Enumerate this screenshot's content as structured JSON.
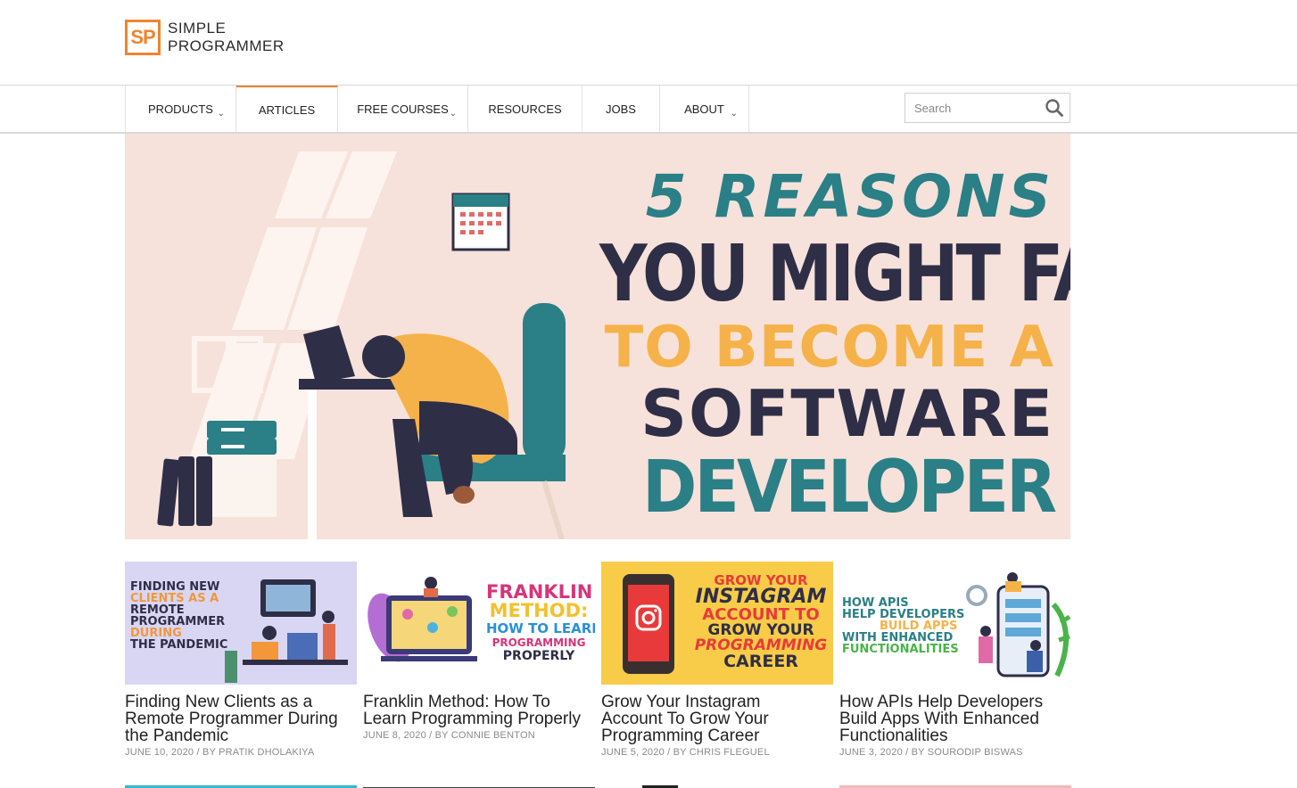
{
  "logo": {
    "mark": "SP",
    "line1": "SIMPLE",
    "line2": "PROGRAMMER"
  },
  "nav": {
    "items": [
      {
        "label": "PRODUCTS",
        "dropdown": true
      },
      {
        "label": "ARTICLES",
        "dropdown": false,
        "active": true
      },
      {
        "label": "FREE COURSES",
        "dropdown": true
      },
      {
        "label": "RESOURCES",
        "dropdown": false
      },
      {
        "label": "JOBS",
        "dropdown": false
      },
      {
        "label": "ABOUT",
        "dropdown": true
      }
    ],
    "dropdown_glyph": "⌄",
    "search_placeholder": "Search"
  },
  "hero": {
    "line1": "5 REASONS",
    "line2": "YOU MIGHT FAIL",
    "line3": "TO BECOME A",
    "line4": "SOFTWARE",
    "line5": "DEVELOPER"
  },
  "articles": [
    {
      "title": "Finding New Clients as a Remote Programmer During the Pandemic",
      "meta": "JUNE 10, 2020 / BY PRATIK DHOLAKIYA",
      "thumb_text": [
        "FINDING NEW",
        "CLIENTS AS A",
        "REMOTE",
        "PROGRAMMER",
        "DURING",
        "THE PANDEMIC"
      ]
    },
    {
      "title": "Franklin Method: How To Learn Programming Properly",
      "meta": "JUNE 8, 2020 / BY CONNIE BENTON",
      "thumb_text": [
        "FRANKLIN",
        "METHOD:",
        "HOW TO LEARN",
        "PROGRAMMING",
        "PROPERLY"
      ]
    },
    {
      "title": "Grow Your Instagram Account To Grow Your Programming Career",
      "meta": "JUNE 5, 2020 / BY CHRIS FLEGUEL",
      "thumb_text": [
        "GROW YOUR",
        "INSTAGRAM",
        "ACCOUNT TO",
        "GROW YOUR",
        "PROGRAMMING",
        "CAREER"
      ]
    },
    {
      "title": "How APIs Help Developers Build Apps With Enhanced Functionalities",
      "meta": "JUNE 3, 2020 / BY SOURODIP BISWAS",
      "thumb_text": [
        "HOW APIS",
        "HELP DEVELOPERS",
        "BUILD APPS",
        "WITH ENHANCED",
        "FUNCTIONALITIES"
      ]
    }
  ],
  "colors": {
    "accent": "#f0842e",
    "hero_bg": "#f6e2da",
    "teal": "#2b7f86",
    "navy": "#2f2e47",
    "yellow": "#f6b24a"
  }
}
